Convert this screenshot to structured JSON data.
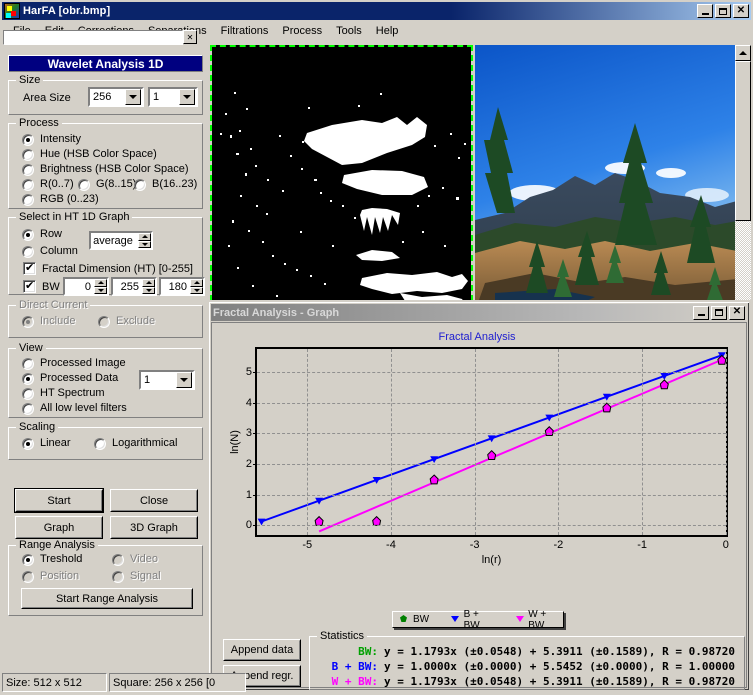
{
  "window": {
    "title": "HarFA [obr.bmp]",
    "icon": "harfa-app-icon",
    "minimize": "_",
    "maximize": "□",
    "close": "✕"
  },
  "menu": [
    "File",
    "Edit",
    "Corrections",
    "Separations",
    "Filtrations",
    "Process",
    "Tools",
    "Help"
  ],
  "left_panel": {
    "header": "Wavelet Analysis 1D",
    "size": {
      "group": "Size",
      "area_size_label": "Area Size",
      "area_size_value": "256",
      "channel_value": "1"
    },
    "process": {
      "group": "Process",
      "options": [
        "Intensity",
        "Hue (HSB Color Space)",
        "Brightness (HSB Color Space)",
        "R(0..7)",
        "G(8..15)",
        "B(16..23)",
        "RGB (0..23)"
      ],
      "selected": "Intensity"
    },
    "select_ht": {
      "group": "Select in HT 1D Graph",
      "row": "Row",
      "column": "Column",
      "selected": "Row",
      "avg_value": "average",
      "fractal_dim": "Fractal Dimension (HT) [0-255]",
      "fractal_dim_checked": true,
      "bw_label": "BW",
      "bw_checked": true,
      "bw_min": "0",
      "bw_max": "255",
      "bw_thr": "180"
    },
    "direct_current": {
      "group": "Direct Current",
      "include": "Include",
      "exclude": "Exclude",
      "selected": "Include",
      "enabled": false
    },
    "view": {
      "group": "View",
      "options": [
        "Processed Image",
        "Processed Data",
        "HT Spectrum",
        "All low level filters"
      ],
      "selected": "Processed Data",
      "data_index": "1"
    },
    "scaling": {
      "group": "Scaling",
      "options": [
        "Linear",
        "Logarithmical"
      ],
      "selected": "Linear"
    },
    "buttons": {
      "start": "Start",
      "close": "Close",
      "graph": "Graph",
      "graph3d": "3D Graph"
    },
    "range_analysis": {
      "group": "Range Analysis",
      "treshold": "Treshold",
      "video": "Video",
      "position": "Position",
      "signal": "Signal",
      "selected": "Treshold",
      "start_button": "Start Range Analysis"
    }
  },
  "statusbar": {
    "size": "Size: 512 x 512",
    "square": "Square: 256 x 256 [0"
  },
  "graph_window": {
    "title": "Fractal Analysis - Graph",
    "icon": "harfa-app-icon",
    "minimize": "_",
    "maximize": "□",
    "close": "✕",
    "buttons": {
      "append_data": "Append data",
      "append_regr": "Append regr."
    },
    "statistics": {
      "group": "Statistics",
      "rows": [
        {
          "tag": "BW:",
          "color": "#00a000",
          "equation": "y = 1.1793x (±0.0548) +  5.3911 (±0.1589), R = 0.98720"
        },
        {
          "tag": "B + BW:",
          "color": "#0000ff",
          "equation": "y = 1.0000x (±0.0000) +  5.5452 (±0.0000), R = 1.00000"
        },
        {
          "tag": "W + BW:",
          "color": "#ff00ff",
          "equation": "y = 1.1793x (±0.0548) +  5.3911 (±0.1589), R = 0.98720"
        }
      ]
    }
  },
  "chart_data": {
    "type": "scatter",
    "title": "Fractal Analysis",
    "xlabel": "ln(r)",
    "ylabel": "ln(N)",
    "xlim": [
      -5.6,
      0.05
    ],
    "ylim": [
      -0.45,
      5.75
    ],
    "xticks": [
      -5,
      -4,
      -3,
      -2,
      -1,
      0
    ],
    "yticks": [
      0,
      1,
      2,
      3,
      4,
      5
    ],
    "grid": true,
    "legend_position": "bottom-center",
    "legend": [
      "BW",
      "B + BW",
      "W + BW"
    ],
    "series": [
      {
        "name": "B + BW",
        "color": "#0000ff",
        "marker": "triangle-down",
        "slope": 1.0,
        "intercept": 5.5452,
        "points": [
          {
            "x": -5.545,
            "y": 0.0
          },
          {
            "x": -4.852,
            "y": 0.693
          },
          {
            "x": -4.159,
            "y": 1.386
          },
          {
            "x": -3.466,
            "y": 2.079
          },
          {
            "x": -2.773,
            "y": 2.773
          },
          {
            "x": -2.079,
            "y": 3.466
          },
          {
            "x": -1.386,
            "y": 4.159
          },
          {
            "x": -0.693,
            "y": 4.852
          },
          {
            "x": 0.0,
            "y": 5.545
          }
        ]
      },
      {
        "name": "W + BW",
        "color": "#ff00ff",
        "marker": "diamond",
        "slope": 1.1793,
        "intercept": 5.3911,
        "points": [
          {
            "x": -4.852,
            "y": 0.0
          },
          {
            "x": -4.159,
            "y": 0.0
          },
          {
            "x": -3.466,
            "y": 1.386
          },
          {
            "x": -2.773,
            "y": 2.197
          },
          {
            "x": -2.079,
            "y": 2.996
          },
          {
            "x": -1.386,
            "y": 3.784
          },
          {
            "x": -0.693,
            "y": 4.554
          },
          {
            "x": 0.0,
            "y": 5.371
          }
        ]
      },
      {
        "name": "BW",
        "color": "#008000",
        "marker": "diamond",
        "slope": 1.1793,
        "intercept": 5.3911,
        "points": []
      }
    ]
  }
}
